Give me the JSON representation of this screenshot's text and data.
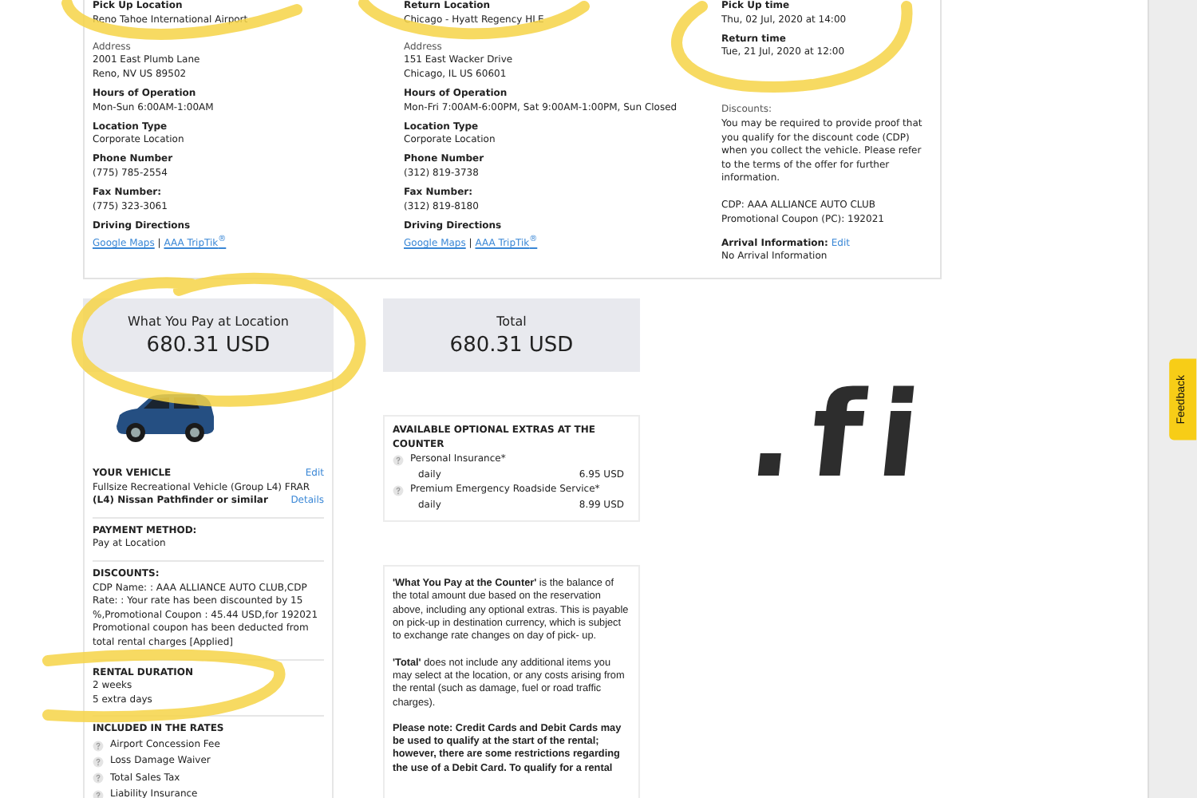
{
  "pickup_location": {
    "heading": "Pick Up Location",
    "value": "Reno Tahoe International Airport",
    "address_label": "Address",
    "address_lines": [
      "2001 East Plumb Lane",
      "Reno, NV US 89502"
    ],
    "fields": [
      {
        "label": "Hours of Operation",
        "value": "Mon-Sun 6:00AM-1:00AM"
      },
      {
        "label": "Location Type",
        "value": "Corporate Location"
      },
      {
        "label": "Phone Number",
        "value": "(775) 785-2554"
      },
      {
        "label": "Fax Number:",
        "value": "(775) 323-3061"
      }
    ],
    "directions": {
      "label": "Driving Directions",
      "links": [
        "Google Maps",
        "AAA TripTik$^{®}$"
      ],
      "separator": "|"
    }
  },
  "return_location": {
    "heading": "Return Location",
    "value": "Chicago - Hyatt Regency HLE",
    "address_label": "Address",
    "address_lines": [
      "151 East Wacker Drive",
      "Chicago, IL US 60601"
    ],
    "fields": [
      {
        "label": "Hours of Operation",
        "value": "Mon-Fri 7:00AM-6:00PM, Sat 9:00AM-1:00PM, Sun Closed"
      },
      {
        "label": "Location Type",
        "value": "Corporate Location"
      },
      {
        "label": "Phone Number",
        "value": "(312) 819-3738"
      },
      {
        "label": "Fax Number:",
        "value": "(312) 819-8180"
      }
    ],
    "directions": {
      "label": "Driving Directions",
      "links": [
        "Google Maps",
        "AAA TripTik$^{®}$"
      ],
      "separator": "|"
    }
  },
  "times": {
    "fields": [
      {
        "label": "Pick Up time",
        "value": "Thu, 02 Jul, 2020 at 14:00"
      },
      {
        "label": "Return time",
        "value": "Tue, 21 Jul, 2020 at 12:00"
      }
    ],
    "discounts": {
      "label": "Discounts:",
      "text": "You may be required to provide proof that you qualify for the discount code (CDP) when you collect the vehicle. Please refer to the terms of the offer for further information.",
      "lines": [
        "CDP: AAA ALLIANCE AUTO CLUB",
        "Promotional Coupon (PC): 192021"
      ]
    },
    "arrival": {
      "label": "Arrival Information:",
      "link": "Edit",
      "value": "No Arrival Information"
    }
  },
  "pay_at_location": {
    "label": "What You Pay at Location",
    "amount": "680.31 USD"
  },
  "vehicle": {
    "heading": "YOUR VEHICLE",
    "edit": "Edit",
    "description": "Fullsize Recreational Vehicle (Group L4) FRAR",
    "model": "(L4) Nissan Pathfinder or similar",
    "details": "Details"
  },
  "payment_method": {
    "heading": "PAYMENT METHOD:",
    "value": "Pay at Location"
  },
  "discounts": {
    "heading": "DISCOUNTS:",
    "text": "CDP Name: : AAA ALLIANCE AUTO CLUB,CDP Rate: : Your rate has been discounted by 15 %,Promotional Coupon : 45.44 USD,for 192021 Promotional coupon has been deducted from total rental charges [Applied]"
  },
  "rental_duration": {
    "heading": "RENTAL DURATION",
    "lines": [
      "2 weeks",
      "5 extra days"
    ]
  },
  "included": {
    "heading": "INCLUDED IN THE RATES",
    "items": [
      "Airport Concession Fee",
      "Loss Damage Waiver",
      "Total Sales Tax",
      "Liability Insurance"
    ]
  },
  "total": {
    "label": "Total",
    "amount": "680.31 USD"
  },
  "extras": {
    "heading": "AVAILABLE OPTIONAL EXTRAS AT THE COUNTER",
    "items": [
      {
        "name": "Personal Insurance*",
        "period": "daily",
        "price": "6.95 USD"
      },
      {
        "name": "Premium Emergency Roadside Service*",
        "period": "daily",
        "price": "8.99 USD"
      }
    ]
  },
  "notes": [
    {
      "text": "**'What You Pay at the Counter'** is the balance of the total amount due based on the reservation above, including any optional extras. This is payable on pick-up in destination currency, which is subject to exchange rate changes on day of pick- up.",
      "bold": false
    },
    {
      "text": "**'Total'** does not include any additional items you may select at the location, or any costs arising from the rental (such as damage, fuel or road traffic charges).",
      "bold": false
    },
    {
      "text": "Please note: Credit Cards and Debit Cards may be used to qualify at the start of the rental; however, there are some restrictions regarding the use of a Debit Card. To qualify for a rental",
      "bold": true
    }
  ],
  "annotation": {
    "text": ".fi"
  },
  "feedback": {
    "label": "Feedback"
  }
}
